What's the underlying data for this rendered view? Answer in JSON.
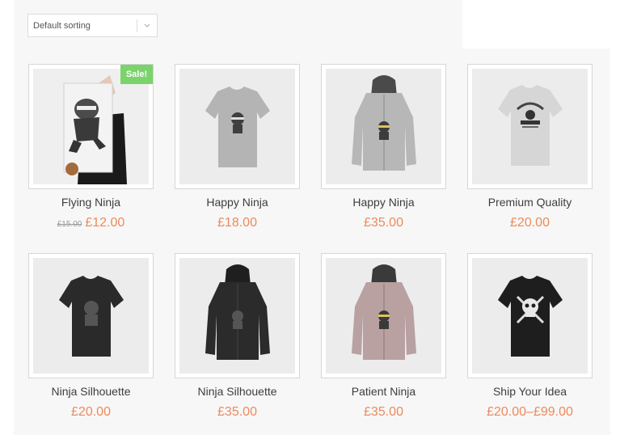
{
  "toolbar": {
    "sort_label": "Default sorting"
  },
  "products": [
    {
      "title": "Flying Ninja",
      "old_price": "£15.00",
      "price": "£12.00",
      "badge": "Sale!",
      "image": "poster-ninja"
    },
    {
      "title": "Happy Ninja",
      "price": "£18.00",
      "image": "tshirt-grey-ninja"
    },
    {
      "title": "Happy Ninja",
      "price": "£35.00",
      "image": "hoodie-grey-ninja"
    },
    {
      "title": "Premium Quality",
      "price": "£20.00",
      "image": "tshirt-grey-woothemes"
    },
    {
      "title": "Ninja Silhouette",
      "price": "£20.00",
      "image": "tshirt-black-silhouette"
    },
    {
      "title": "Ninja Silhouette",
      "price": "£35.00",
      "image": "hoodie-black-silhouette"
    },
    {
      "title": "Patient Ninja",
      "price": "£35.00",
      "image": "hoodie-pink-ninja"
    },
    {
      "title": "Ship Your Idea",
      "price": "£20.00–£99.00",
      "image": "tshirt-black-skull"
    }
  ],
  "colors": {
    "accent": "#ed8a5c",
    "sale_badge": "#7bd36c"
  }
}
